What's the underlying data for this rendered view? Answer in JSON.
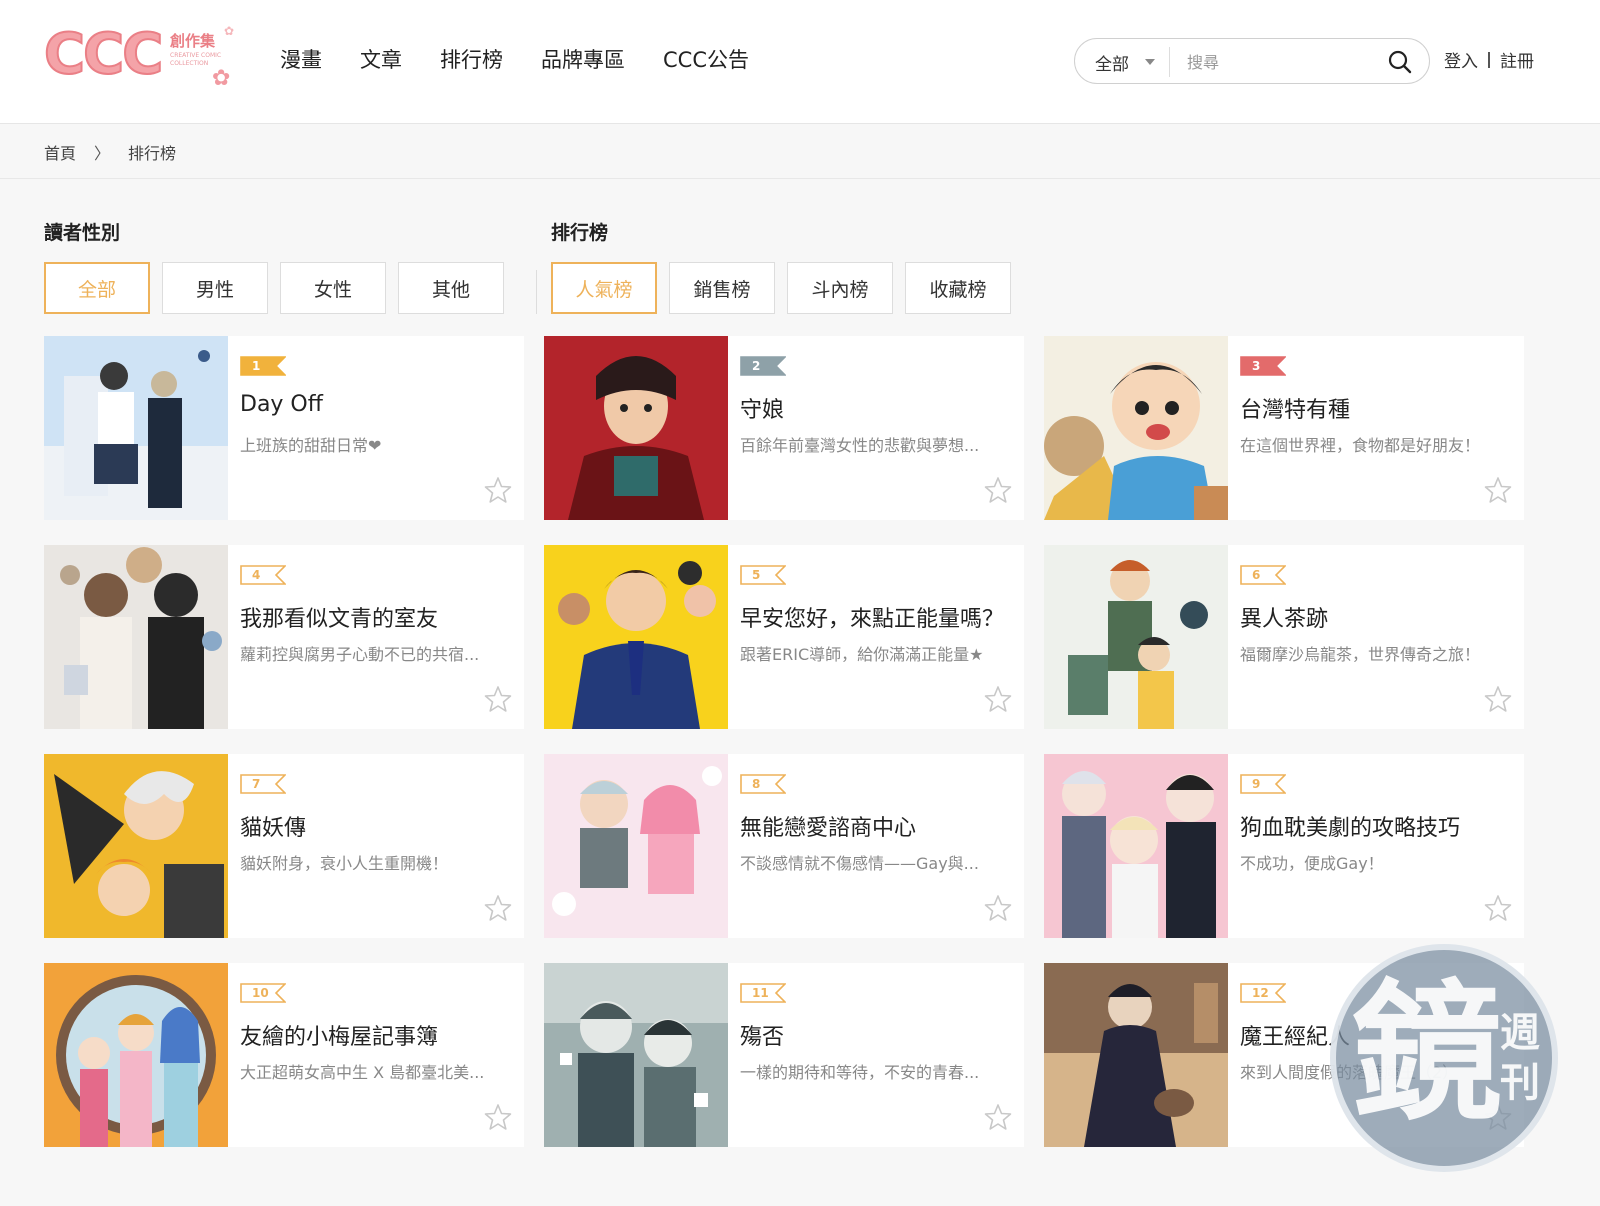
{
  "header": {
    "logo_text": "CCC",
    "logo_sub": "創作集",
    "logo_sub2": "CREATIVE COMIC COLLECTION",
    "nav": [
      "漫畫",
      "文章",
      "排行榜",
      "品牌專區",
      "CCC公告"
    ],
    "search_scope": "全部",
    "search_placeholder": "搜尋",
    "login": "登入",
    "register": "註冊"
  },
  "breadcrumb": {
    "home": "首頁",
    "current": "排行榜"
  },
  "filters": {
    "gender_title": "讀者性別",
    "gender_options": [
      "全部",
      "男性",
      "女性",
      "其他"
    ],
    "gender_selected": "全部",
    "rank_title": "排行榜",
    "rank_options": [
      "人氣榜",
      "銷售榜",
      "斗內榜",
      "收藏榜"
    ],
    "rank_selected": "人氣榜"
  },
  "colors": {
    "accent": "#eeb25a",
    "rank1": "#f1b23c",
    "rank2": "#8ea1a8",
    "rank3": "#e36b6b",
    "rank_other": "#eeb25a"
  },
  "cards": [
    {
      "rank": "1",
      "title": "Day Off",
      "desc": "上班族的甜甜日常❤",
      "thumb": "sky"
    },
    {
      "rank": "2",
      "title": "守娘",
      "desc": "百餘年前臺灣女性的悲歡與夢想...",
      "thumb": "red"
    },
    {
      "rank": "3",
      "title": "台灣特有種",
      "desc": "在這個世界裡，食物都是好朋友！",
      "thumb": "boy"
    },
    {
      "rank": "4",
      "title": "我那看似文青的室友",
      "desc": "蘿莉控與腐男子心動不已的共宿...",
      "thumb": "room"
    },
    {
      "rank": "5",
      "title": "早安您好，來點正能量嗎？",
      "desc": "跟著ERIC導師，給你滿滿正能量★",
      "thumb": "yellow"
    },
    {
      "rank": "6",
      "title": "異人茶跡",
      "desc": "福爾摩沙烏龍茶，世界傳奇之旅！",
      "thumb": "tea"
    },
    {
      "rank": "7",
      "title": "貓妖傳",
      "desc": "貓妖附身，衰小人生重開機！",
      "thumb": "cat"
    },
    {
      "rank": "8",
      "title": "無能戀愛諮商中心",
      "desc": "不談感情就不傷感情——Gay與...",
      "thumb": "pink"
    },
    {
      "rank": "9",
      "title": "狗血耽美劇的攻略技巧",
      "desc": "不成功，便成Gay！",
      "thumb": "suits"
    },
    {
      "rank": "10",
      "title": "友繪的小梅屋記事簿",
      "desc": "大正超萌女高中生 X 島都臺北美...",
      "thumb": "kimono"
    },
    {
      "rank": "11",
      "title": "殤否",
      "desc": "一樣的期待和等待，不安的青春...",
      "thumb": "grey"
    },
    {
      "rank": "12",
      "title": "魔王經紀人",
      "desc": "來到人間度假的落魄魔王（2）",
      "thumb": "demon"
    }
  ],
  "watermark": {
    "main": "鏡",
    "side1": "週",
    "side2": "刊"
  }
}
